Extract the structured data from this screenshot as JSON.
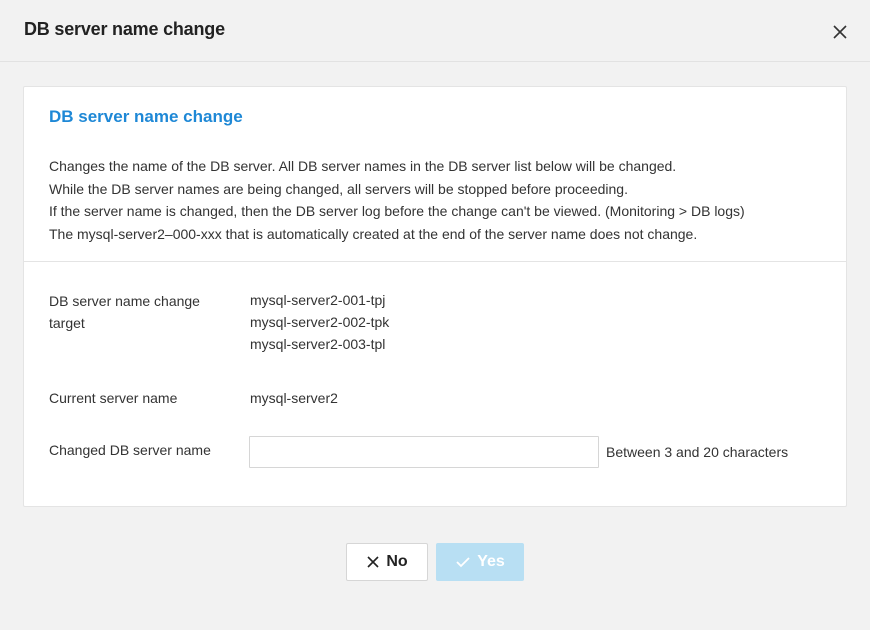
{
  "dialog": {
    "title": "DB server name change",
    "close_icon": "close-icon"
  },
  "card": {
    "section_title": "DB server name change",
    "description": [
      "Changes the name of the DB server. All DB server names in the DB server list below will be changed.",
      "While the DB server names are being changed, all servers will be stopped before proceeding.",
      "If the server name is changed, then the DB server log before the change can't be viewed. (Monitoring > DB logs)",
      "The mysql-server2–000-xxx that is automatically created at the end of the server name does not change."
    ],
    "target_label_line1": "DB server name change",
    "target_label_line2": "target",
    "targets": [
      "mysql-server2-001-tpj",
      "mysql-server2-002-tpk",
      "mysql-server2-003-tpl"
    ],
    "current_label": "Current server name",
    "current_value": "mysql-server2",
    "changed_label": "Changed DB server name",
    "changed_value": "",
    "changed_placeholder": "",
    "changed_hint": "Between 3 and 20 characters"
  },
  "footer": {
    "no_label": "No",
    "no_icon": "close-icon",
    "yes_label": "Yes",
    "yes_icon": "check-icon",
    "yes_disabled": true
  },
  "colors": {
    "accent": "#1e88d6",
    "yes_disabled_bg": "#b8dff3"
  }
}
